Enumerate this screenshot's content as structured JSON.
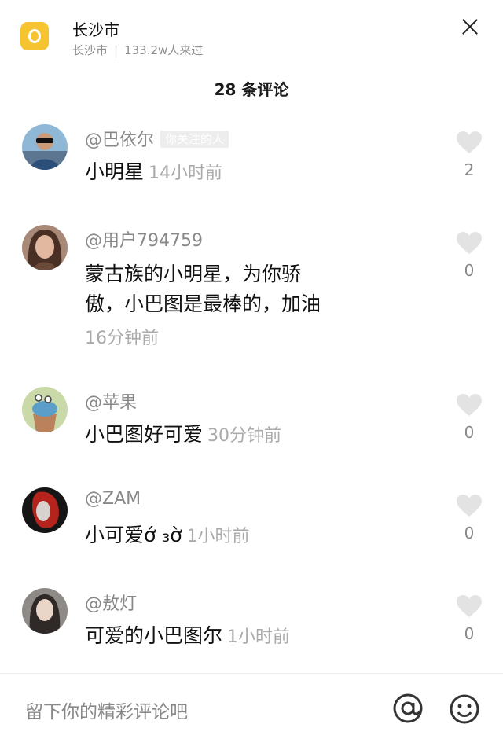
{
  "header": {
    "title": "长沙市",
    "subtitle_city": "长沙市",
    "subtitle_sep": "|",
    "visitors": "133.2w人来过"
  },
  "comment_count": "28 条评论",
  "comments": [
    {
      "username": "@巴依尔",
      "tag": "你关注的人",
      "text": "小明星",
      "time": "14小时前",
      "likes": "2"
    },
    {
      "username": "@用户794759",
      "text_line1": "蒙古族的小明星，为你骄",
      "text_line2": "傲，小巴图是最棒的，加油",
      "time": "16分钟前",
      "likes": "0"
    },
    {
      "username": "@苹果",
      "text": "小巴图好可爱",
      "time": "30分钟前",
      "likes": "0"
    },
    {
      "username": "@ZAM",
      "text": "小可爱ớ ₃ờ",
      "time": "1小时前",
      "likes": "0"
    },
    {
      "username": "@敖灯",
      "text": "可爱的小巴图尔",
      "time": "1小时前",
      "likes": "0"
    }
  ],
  "input": {
    "placeholder": "留下你的精彩评论吧"
  },
  "icons": {
    "logo": "location-logo-icon",
    "close": "close-icon",
    "like": "heart-icon",
    "mention": "at-icon",
    "emoji": "smiley-icon"
  },
  "colors": {
    "accent": "#f6c431",
    "heart": "#e3e3e3"
  }
}
